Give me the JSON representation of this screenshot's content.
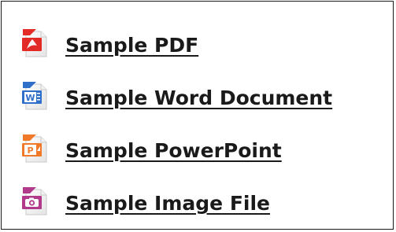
{
  "files": [
    {
      "label": "Sample PDF",
      "icon": "pdf-file-icon",
      "accent": "#e22b26"
    },
    {
      "label": "Sample Word Document",
      "icon": "word-file-icon",
      "accent": "#2f6fc9"
    },
    {
      "label": "Sample PowerPoint",
      "icon": "powerpoint-file-icon",
      "accent": "#f07a2a"
    },
    {
      "label": "Sample Image File",
      "icon": "image-file-icon",
      "accent": "#b23a8a"
    }
  ]
}
